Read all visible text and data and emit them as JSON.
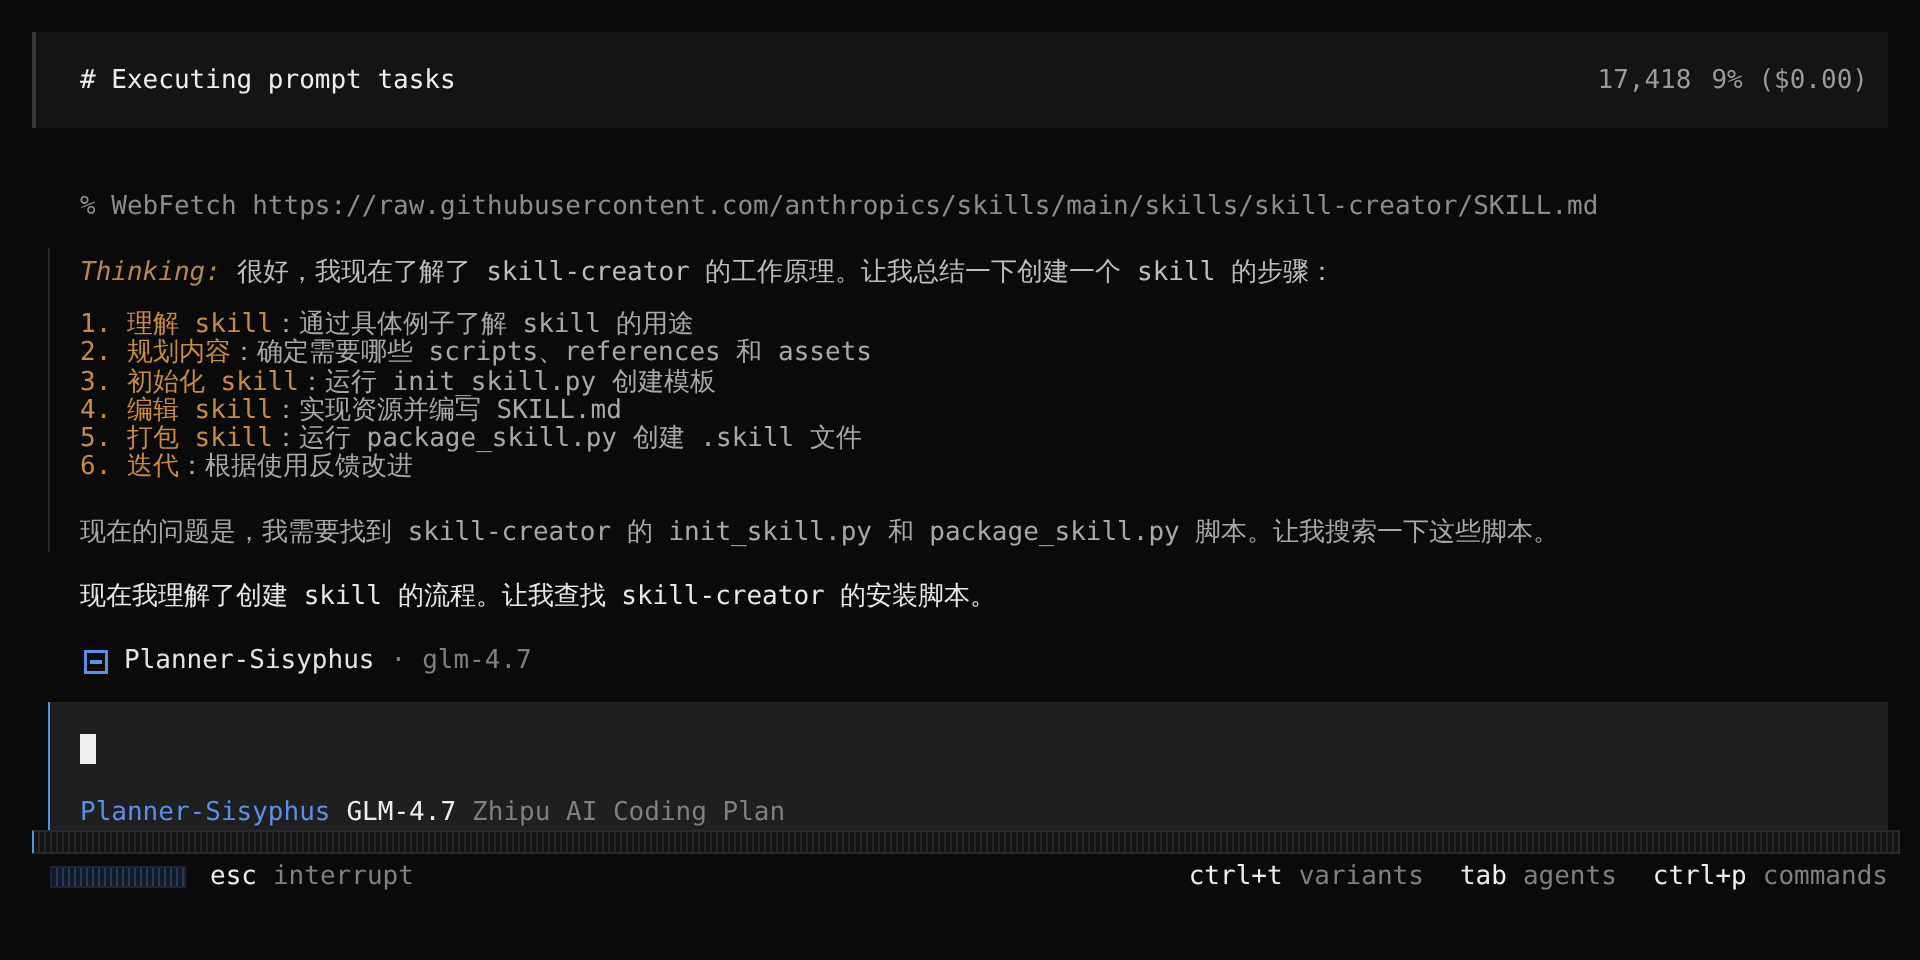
{
  "header": {
    "title": "# Executing prompt tasks",
    "tokens": "17,418",
    "usage": "9% ($0.00)"
  },
  "tool_call": "% WebFetch https://raw.githubusercontent.com/anthropics/skills/main/skills/skill-creator/SKILL.md",
  "thinking": {
    "label": "Thinking:",
    "text": "很好，我现在了解了 skill-creator 的工作原理。让我总结一下创建一个 skill 的步骤：",
    "steps": [
      {
        "number": "1.",
        "title": "理解 skill",
        "text": "：通过具体例子了解 skill 的用途"
      },
      {
        "number": "2.",
        "title": "规划内容",
        "text": "：确定需要哪些 scripts、references 和 assets"
      },
      {
        "number": "3.",
        "title": "初始化 skill",
        "text": "：运行 init_skill.py 创建模板"
      },
      {
        "number": "4.",
        "title": "编辑 skill",
        "text": "：实现资源并编写 SKILL.md"
      },
      {
        "number": "5.",
        "title": "打包 skill",
        "text": "：运行 package_skill.py 创建 .skill 文件"
      },
      {
        "number": "6.",
        "title": "迭代",
        "text": "：根据使用反馈改进"
      }
    ],
    "paragraph": "现在的问题是，我需要找到 skill-creator 的 init_skill.py 和 package_skill.py 脚本。让我搜索一下这些脚本。"
  },
  "message": "现在我理解了创建 skill 的流程。让我查找 skill-creator 的安装脚本。",
  "agent_line": {
    "agent": "Planner-Sisyphus",
    "separator": "·",
    "model": "glm-4.7"
  },
  "input": {
    "agent": "Planner-Sisyphus",
    "model": "GLM-4.7",
    "provider": "Zhipu AI Coding Plan"
  },
  "interrupt": {
    "key": "esc",
    "label": "interrupt"
  },
  "shortcuts": [
    {
      "key": "ctrl+t",
      "label": "variants"
    },
    {
      "key": "tab",
      "label": "agents"
    },
    {
      "key": "ctrl+p",
      "label": "commands"
    }
  ]
}
